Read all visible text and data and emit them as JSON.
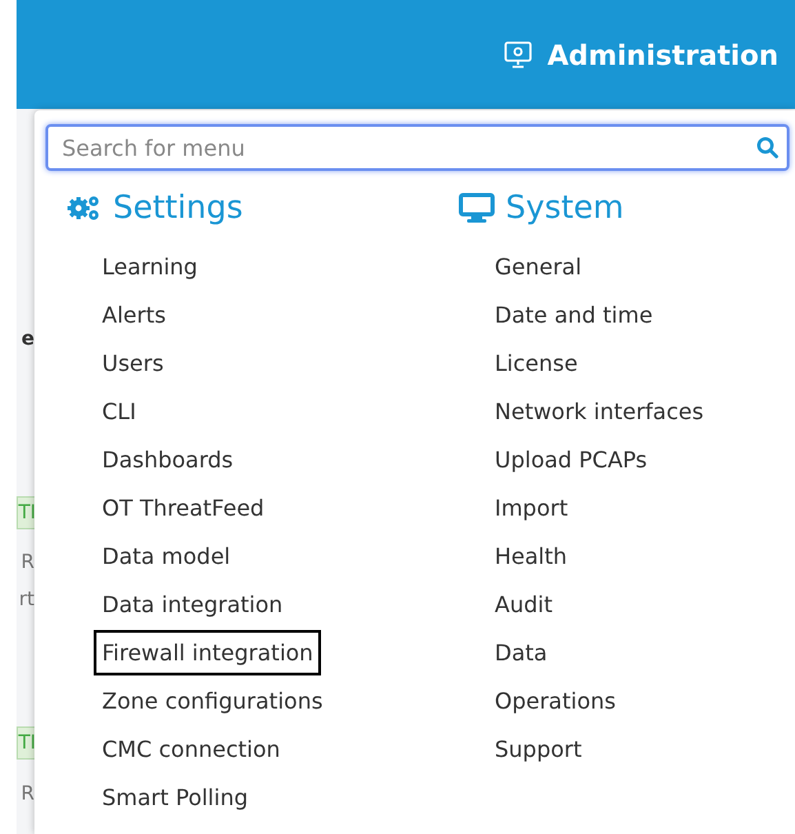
{
  "header": {
    "title": "Administration"
  },
  "background_fragments": [
    {
      "text": "e",
      "kind": "text"
    },
    {
      "text": "TI",
      "kind": "tag"
    },
    {
      "text": "R",
      "kind": "text"
    },
    {
      "text": "rt",
      "kind": "text"
    },
    {
      "text": "TI",
      "kind": "tag"
    },
    {
      "text": "R",
      "kind": "text"
    }
  ],
  "search": {
    "placeholder": "Search for menu"
  },
  "columns": [
    {
      "title": "Settings",
      "kind": "settings",
      "items": [
        {
          "label": "Learning",
          "highlighted": false
        },
        {
          "label": "Alerts",
          "highlighted": false
        },
        {
          "label": "Users",
          "highlighted": false
        },
        {
          "label": "CLI",
          "highlighted": false
        },
        {
          "label": "Dashboards",
          "highlighted": false
        },
        {
          "label": "OT ThreatFeed",
          "highlighted": false
        },
        {
          "label": "Data model",
          "highlighted": false
        },
        {
          "label": "Data integration",
          "highlighted": false
        },
        {
          "label": "Firewall integration",
          "highlighted": true
        },
        {
          "label": "Zone configurations",
          "highlighted": false
        },
        {
          "label": "CMC connection",
          "highlighted": false
        },
        {
          "label": "Smart Polling",
          "highlighted": false
        }
      ]
    },
    {
      "title": "System",
      "kind": "system",
      "items": [
        {
          "label": "General",
          "highlighted": false
        },
        {
          "label": "Date and time",
          "highlighted": false
        },
        {
          "label": "License",
          "highlighted": false
        },
        {
          "label": "Network interfaces",
          "highlighted": false
        },
        {
          "label": "Upload PCAPs",
          "highlighted": false
        },
        {
          "label": "Import",
          "highlighted": false
        },
        {
          "label": "Health",
          "highlighted": false
        },
        {
          "label": "Audit",
          "highlighted": false
        },
        {
          "label": "Data",
          "highlighted": false
        },
        {
          "label": "Operations",
          "highlighted": false
        },
        {
          "label": "Support",
          "highlighted": false
        }
      ]
    }
  ]
}
